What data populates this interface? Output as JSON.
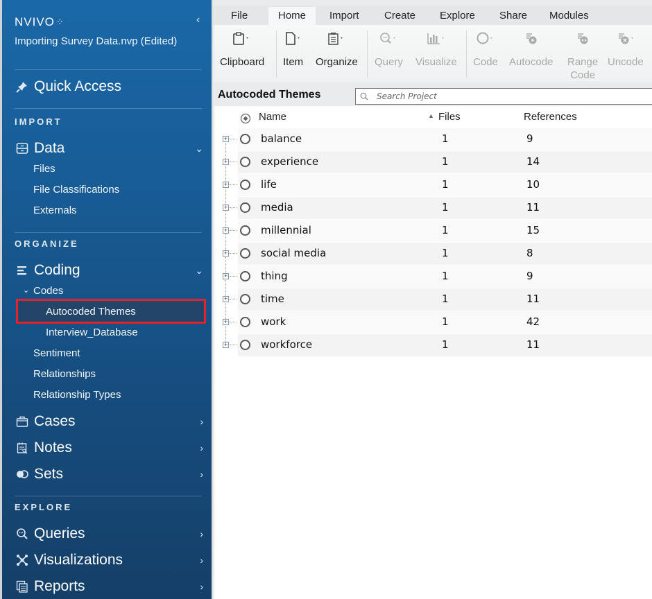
{
  "app": {
    "logo": "NVIVO",
    "project_title": "Importing Survey Data.nvp (Edited)",
    "collapse_icon": "chevron-left-icon"
  },
  "sidebar": {
    "quick_access": {
      "label": "Quick Access",
      "icon": "pin-icon"
    },
    "sections": {
      "import": "IMPORT",
      "organize": "ORGANIZE",
      "explore": "EXPLORE"
    },
    "data": {
      "label": "Data",
      "icon": "cabinet-icon",
      "expanded": true,
      "items": [
        "Files",
        "File Classifications",
        "Externals"
      ]
    },
    "coding": {
      "label": "Coding",
      "icon": "list-icon",
      "expanded": true,
      "codes_label": "Codes",
      "codes_items": [
        "Autocoded Themes",
        "Interview_Database"
      ],
      "selected": "Autocoded Themes",
      "items": [
        "Sentiment",
        "Relationships",
        "Relationship Types"
      ]
    },
    "cases": {
      "label": "Cases",
      "icon": "briefcase-icon"
    },
    "notes": {
      "label": "Notes",
      "icon": "notes-icon"
    },
    "sets": {
      "label": "Sets",
      "icon": "toggle-icon"
    },
    "queries": {
      "label": "Queries",
      "icon": "query-icon"
    },
    "visualizations": {
      "label": "Visualizations",
      "icon": "network-icon"
    },
    "reports": {
      "label": "Reports",
      "icon": "report-icon"
    }
  },
  "ribbon": {
    "tabs": [
      "File",
      "Home",
      "Import",
      "Create",
      "Explore",
      "Share",
      "Modules"
    ],
    "active_tab": "Home",
    "buttons": [
      {
        "label": "Clipboard",
        "icon": "clipboard-icon",
        "enabled": true
      },
      {
        "label": "Item",
        "icon": "document-icon",
        "enabled": true
      },
      {
        "label": "Organize",
        "icon": "organize-icon",
        "enabled": true
      },
      {
        "label": "Query",
        "icon": "query-icon",
        "enabled": false
      },
      {
        "label": "Visualize",
        "icon": "bar-chart-icon",
        "enabled": false
      },
      {
        "label": "Code",
        "icon": "circle-icon",
        "enabled": false
      },
      {
        "label": "Autocode",
        "icon": "autocode-icon",
        "enabled": false
      },
      {
        "label": "Range Code",
        "label_line1": "Range",
        "label_line2": "Code",
        "icon": "range-code-icon",
        "enabled": false
      },
      {
        "label": "Uncode",
        "icon": "uncode-icon",
        "enabled": false
      }
    ]
  },
  "list": {
    "title": "Autocoded Themes",
    "search_placeholder": "Search Project",
    "columns": {
      "name": "Name",
      "files": "Files",
      "references": "References"
    },
    "sort_column": "Files",
    "sort_direction": "ascending",
    "rows": [
      {
        "name": "balance",
        "files": "1",
        "references": "9"
      },
      {
        "name": "experience",
        "files": "1",
        "references": "14"
      },
      {
        "name": "life",
        "files": "1",
        "references": "10"
      },
      {
        "name": "media",
        "files": "1",
        "references": "11"
      },
      {
        "name": "millennial",
        "files": "1",
        "references": "15"
      },
      {
        "name": "social media",
        "files": "1",
        "references": "8"
      },
      {
        "name": "thing",
        "files": "1",
        "references": "9"
      },
      {
        "name": "time",
        "files": "1",
        "references": "11"
      },
      {
        "name": "work",
        "files": "1",
        "references": "42"
      },
      {
        "name": "workforce",
        "files": "1",
        "references": "11"
      }
    ]
  },
  "colors": {
    "sidebar_top": "#1a68a8",
    "sidebar_bottom": "#153f68",
    "selection_outline": "#e0242f",
    "selection_fill": "#23456a"
  }
}
